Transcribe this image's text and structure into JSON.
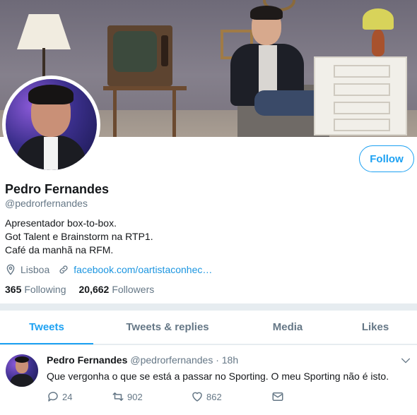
{
  "profile": {
    "name": "Pedro Fernandes",
    "handle": "@pedrorfernandes",
    "bio": [
      "Apresentador box-to-box.",
      "Got Talent e Brainstorm na RTP1.",
      "Café da manhã na RFM."
    ],
    "location": "Lisboa",
    "website": "facebook.com/oartistaconhec…",
    "following_count": "365",
    "following_label": "Following",
    "followers_count": "20,662",
    "followers_label": "Followers",
    "follow_label": "Follow"
  },
  "tabs": [
    {
      "label": "Tweets",
      "active": true
    },
    {
      "label": "Tweets & replies",
      "active": false
    },
    {
      "label": "Media",
      "active": false
    },
    {
      "label": "Likes",
      "active": false
    }
  ],
  "tweet": {
    "author_name": "Pedro Fernandes",
    "author_handle": "@pedrorfernandes · 18h",
    "text": "Que vergonha o que se está a passar no Sporting. O meu Sporting não é isto.",
    "replies": "24",
    "retweets": "902",
    "likes": "862"
  },
  "colors": {
    "accent": "#1da1f2",
    "link": "#1b95e0",
    "muted": "#657786",
    "text": "#14171a"
  },
  "icons": [
    "location-icon",
    "link-icon",
    "chevron-down-icon",
    "reply-icon",
    "retweet-icon",
    "like-icon",
    "message-icon"
  ]
}
